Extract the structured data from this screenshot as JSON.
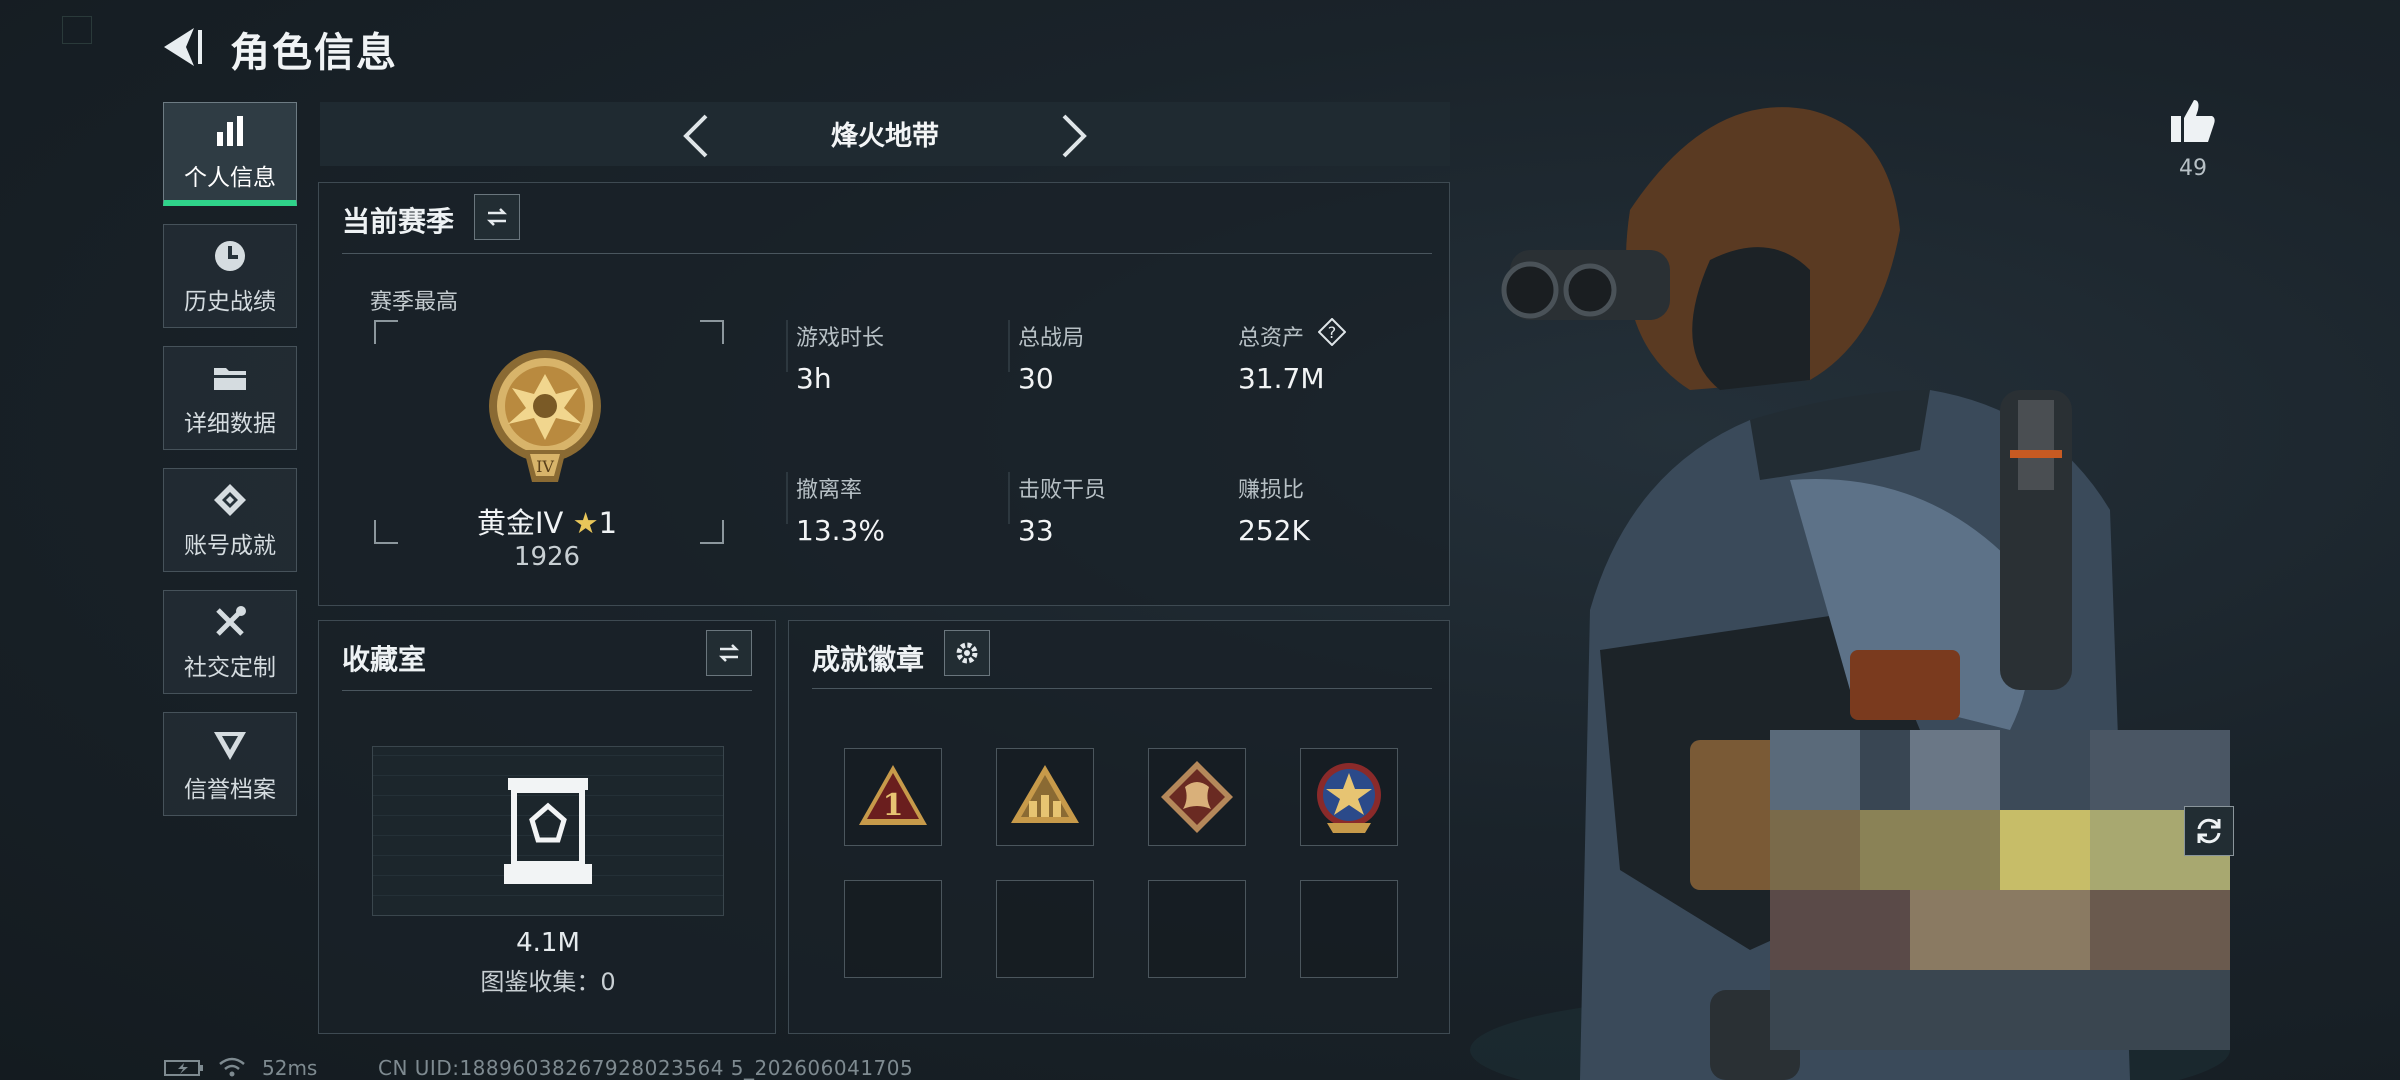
{
  "header": {
    "title": "角色信息"
  },
  "nav": {
    "items": [
      {
        "label": "个人信息",
        "icon": "bar-chart-icon",
        "active": true
      },
      {
        "label": "历史战绩",
        "icon": "clock-icon"
      },
      {
        "label": "详细数据",
        "icon": "folder-icon"
      },
      {
        "label": "账号成就",
        "icon": "achievement-icon"
      },
      {
        "label": "社交定制",
        "icon": "tools-icon"
      },
      {
        "label": "信誉档案",
        "icon": "shield-emblem-icon"
      }
    ]
  },
  "mode": {
    "title": "烽火地带"
  },
  "season": {
    "title": "当前赛季",
    "best_label": "赛季最高",
    "rank_name": "黄金IV",
    "rank_stars": "1",
    "rank_score": "1926",
    "rank_numeral": "IV",
    "stats": [
      {
        "label": "游戏时长",
        "value": "3h"
      },
      {
        "label": "总战局",
        "value": "30"
      },
      {
        "label": "总资产",
        "value": "31.7M"
      },
      {
        "label": "撤离率",
        "value": "13.3%"
      },
      {
        "label": "击败干员",
        "value": "33"
      },
      {
        "label": "赚损比",
        "value": "252K"
      }
    ],
    "help_glyph": "?"
  },
  "collection": {
    "title": "收藏室",
    "value": "4.1M",
    "catalog_label": "图鉴收集：",
    "catalog_count": "0"
  },
  "badges": {
    "title": "成就徽章",
    "items": [
      {
        "name": "rank-one-badge",
        "numeral": "1",
        "filled": true
      },
      {
        "name": "squad-badge",
        "filled": true
      },
      {
        "name": "dragon-badge",
        "filled": true
      },
      {
        "name": "star-crest-badge",
        "filled": true
      },
      {
        "filled": false
      },
      {
        "filled": false
      },
      {
        "filled": false
      },
      {
        "filled": false
      }
    ]
  },
  "like": {
    "count": "49"
  },
  "status": {
    "ping": "52ms",
    "uid": "CN UID:18896038267928023564 5_202606041705"
  },
  "colors": {
    "accent": "#2fd38a",
    "gold": "#c79a4a",
    "panel_border": "#3e4a52"
  }
}
